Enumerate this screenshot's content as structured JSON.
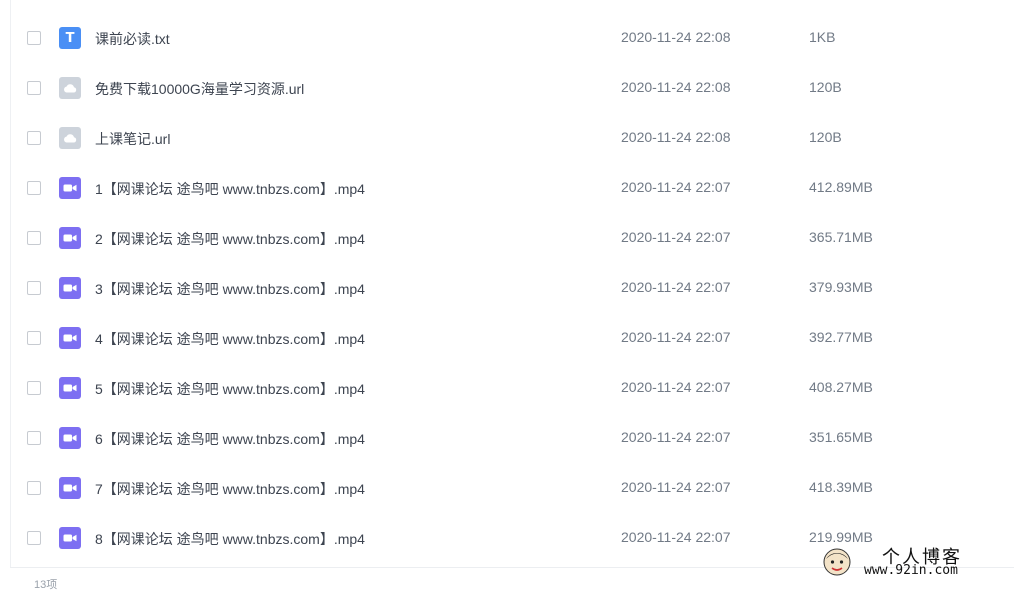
{
  "files": [
    {
      "name": "课前必读.txt",
      "date": "2020-11-24 22:08",
      "size": "1KB",
      "icon": "txt-file-icon"
    },
    {
      "name": "免费下载10000G海量学习资源.url",
      "date": "2020-11-24 22:08",
      "size": "120B",
      "icon": "url-file-icon"
    },
    {
      "name": "上课笔记.url",
      "date": "2020-11-24 22:08",
      "size": "120B",
      "icon": "url-file-icon"
    },
    {
      "name": "1【网课论坛 途鸟吧 www.tnbzs.com】.mp4",
      "date": "2020-11-24 22:07",
      "size": "412.89MB",
      "icon": "video-file-icon"
    },
    {
      "name": "2【网课论坛 途鸟吧 www.tnbzs.com】.mp4",
      "date": "2020-11-24 22:07",
      "size": "365.71MB",
      "icon": "video-file-icon"
    },
    {
      "name": "3【网课论坛 途鸟吧 www.tnbzs.com】.mp4",
      "date": "2020-11-24 22:07",
      "size": "379.93MB",
      "icon": "video-file-icon"
    },
    {
      "name": "4【网课论坛 途鸟吧 www.tnbzs.com】.mp4",
      "date": "2020-11-24 22:07",
      "size": "392.77MB",
      "icon": "video-file-icon"
    },
    {
      "name": "5【网课论坛 途鸟吧 www.tnbzs.com】.mp4",
      "date": "2020-11-24 22:07",
      "size": "408.27MB",
      "icon": "video-file-icon"
    },
    {
      "name": "6【网课论坛 途鸟吧 www.tnbzs.com】.mp4",
      "date": "2020-11-24 22:07",
      "size": "351.65MB",
      "icon": "video-file-icon"
    },
    {
      "name": "7【网课论坛 途鸟吧 www.tnbzs.com】.mp4",
      "date": "2020-11-24 22:07",
      "size": "418.39MB",
      "icon": "video-file-icon"
    },
    {
      "name": "8【网课论坛 途鸟吧 www.tnbzs.com】.mp4",
      "date": "2020-11-24 22:07",
      "size": "219.99MB",
      "icon": "video-file-icon"
    }
  ],
  "footer": {
    "count": "13项"
  },
  "watermark": {
    "title": "个人博客",
    "url": "www.92in.com"
  },
  "colors": {
    "txt": "#4a8ff5",
    "url": "#cdd3db",
    "video": "#7d6ff2"
  }
}
